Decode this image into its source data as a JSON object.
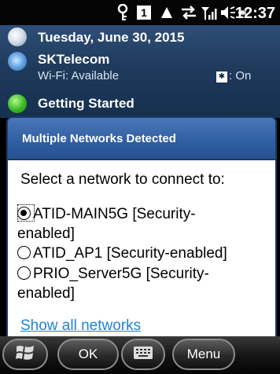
{
  "status_bar": {
    "time": "12:37",
    "sim_label": "1",
    "icons": [
      "key-icon",
      "sim-icon",
      "alert-icon",
      "data-sync-icon",
      "signal-icon",
      "volume-icon",
      "battery-icon"
    ]
  },
  "today": {
    "date": "Tuesday, June 30, 2015",
    "carrier": "SKTelecom",
    "wifi_status": "Wi-Fi: Available",
    "bluetooth_status": ": On",
    "getting_started": "Getting Started"
  },
  "dialog": {
    "title": "Multiple Networks Detected",
    "prompt": "Select a network to connect to:",
    "networks": [
      {
        "line1": "ATID-MAIN5G [Security-",
        "line2": "enabled]",
        "selected": true
      },
      {
        "line1": "ATID_AP1 [Security-enabled]",
        "line2": "",
        "selected": false
      },
      {
        "line1": "PRIO_Server5G [Security-",
        "line2": "enabled]",
        "selected": false
      }
    ],
    "show_all_link": "Show all networks"
  },
  "softkeys": {
    "ok": "OK",
    "menu": "Menu"
  },
  "colors": {
    "title_bar": "#2f5ea2",
    "link": "#1e83d8",
    "today_bg": "#1f3a5c"
  }
}
